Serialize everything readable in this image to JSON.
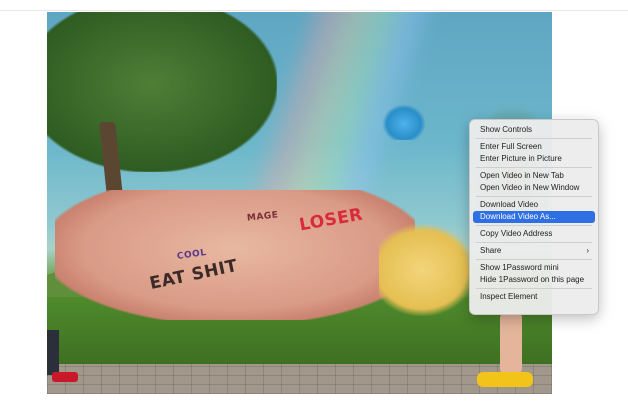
{
  "context_menu": {
    "items": [
      {
        "label": "Show Controls"
      },
      {
        "label": "Enter Full Screen"
      },
      {
        "label": "Enter Picture in Picture"
      },
      {
        "label": "Open Video in New Tab"
      },
      {
        "label": "Open Video in New Window"
      },
      {
        "label": "Download Video"
      },
      {
        "label": "Download Video As...",
        "highlighted": true
      },
      {
        "label": "Copy Video Address"
      },
      {
        "label": "Share",
        "submenu_icon": "chevron-right-icon"
      },
      {
        "label": "Show 1Password mini"
      },
      {
        "label": "Hide 1Password on this page"
      },
      {
        "label": "Inspect Element"
      }
    ]
  },
  "video": {
    "tattoos": {
      "loser": "LOSER",
      "fat": "EAT SHIT",
      "cool": "COOL",
      "mage": "MAGE"
    }
  },
  "colors": {
    "menu_highlight": "#2f6fe4",
    "menu_background": "#ececec"
  }
}
